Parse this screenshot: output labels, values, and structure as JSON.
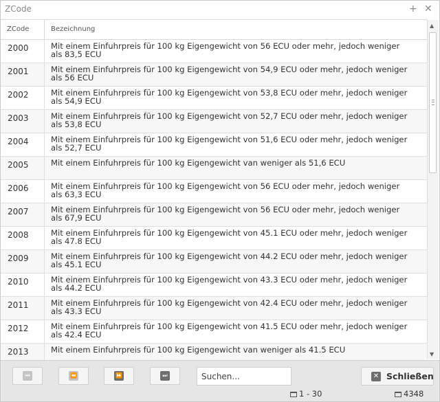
{
  "window": {
    "title": "ZCode",
    "maximize_glyph": "+",
    "close_glyph": "✕"
  },
  "grid": {
    "columns": [
      "ZCode",
      "Bezeichnung"
    ],
    "rows": [
      {
        "code": "2000",
        "text": "Mit einem Einfuhrpreis für 100 kg Eigengewicht von 56 ECU oder mehr, jedoch weniger als 83,5 ECU"
      },
      {
        "code": "2001",
        "text": "Mit einem Einfuhrpreis für 100 kg Eigengewicht von 54,9 ECU oder mehr, jedoch weniger als 56 ECU"
      },
      {
        "code": "2002",
        "text": "Mit einem Einfuhrpreis für 100 kg Eigengewicht von 53,8 ECU oder mehr, jedoch weniger als 54,9 ECU"
      },
      {
        "code": "2003",
        "text": "Mit einem Einfuhrpreis für 100 kg Eigengewicht von 52,7 ECU oder mehr, jedoch weniger als 53,8 ECU"
      },
      {
        "code": "2004",
        "text": "Mit einem Einfuhrpreis für 100 kg Eigengewicht von 51,6 ECU oder mehr, jedoch weniger als 52,7 ECU"
      },
      {
        "code": "2005",
        "text": "Mit einem Einfuhrpreis für 100 kg Eigengewicht van weniger als 51,6 ECU"
      },
      {
        "code": "2006",
        "text": "Mit einem Einfuhrpreis für 100 kg Eigengewicht von 56 ECU oder mehr, jedoch weniger als 63,3 ECU"
      },
      {
        "code": "2007",
        "text": "Mit einem Einfuhrpreis für 100 kg Eigengewicht von 56 ECU oder mehr, jedoch weniger als 67,9 ECU"
      },
      {
        "code": "2008",
        "text": "Mit einem Einfuhrpreis für 100 kg Eigengewicht von 45.1 ECU oder mehr, jedoch weniger als 47.8 ECU"
      },
      {
        "code": "2009",
        "text": "Mit einem Einfuhrpreis für 100 kg Eigengewicht von 44.2 ECU oder mehr, jedoch weniger als 45.1 ECU"
      },
      {
        "code": "2010",
        "text": "Mit einem Einfuhrpreis für 100 kg Eigengewicht von 43.3 ECU oder mehr, jedoch weniger als 44.2 ECU"
      },
      {
        "code": "2011",
        "text": "Mit einem Einfuhrpreis für 100 kg Eigengewicht von 42.4 ECU oder mehr, jedoch weniger als 43.3 ECU"
      },
      {
        "code": "2012",
        "text": "Mit einem Einfuhrpreis für 100 kg Eigengewicht von 41.5 ECU oder mehr, jedoch weniger als 42.4 ECU"
      },
      {
        "code": "2013",
        "text": "Mit einem Einfuhrpreis für 100 kg Eigengewicht van weniger als 41.5 ECU"
      }
    ]
  },
  "footer": {
    "pager_icons": {
      "first": "first-page-icon",
      "prev": "previous-page-icon",
      "next": "next-page-icon",
      "last": "last-page-icon"
    },
    "pager_glyphs": {
      "first": "⏮",
      "prev": "⏪",
      "next": "⏩",
      "last": "⏭"
    },
    "search_placeholder": "Suchen...",
    "close_label": "Schließen",
    "close_glyph": "✕",
    "range_text": "1 - 30",
    "total_text": "4348"
  },
  "colors": {
    "footer_bg": "#e6e6e6",
    "title_text": "#8a8a8a",
    "row_alt": "#f7f7f7",
    "border": "#d9d9d9"
  }
}
